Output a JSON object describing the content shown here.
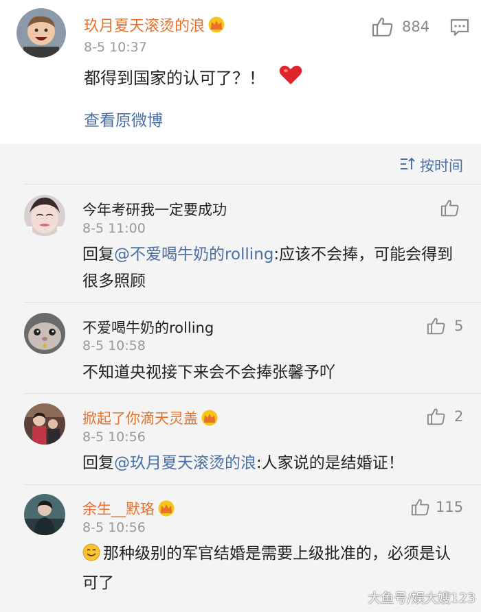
{
  "post": {
    "username": "玖月夏天滚烫的浪",
    "time": "8-5 10:37",
    "content": "都得到国家的认可了？！",
    "likes": "884",
    "view_original": "查看原微博"
  },
  "sort_label": "按时间",
  "comments": [
    {
      "username": "今年考研我一定要成功",
      "time": "8-5 11:00",
      "reply_prefix": "回复",
      "mention": "@不爱喝牛奶的rolling",
      "text": ":应该不会捧，可能会得到很多照顾",
      "likes": ""
    },
    {
      "username": "不爱喝牛奶的rolling",
      "time": "8-5 10:58",
      "text": "不知道央视接下来会不会捧张馨予吖",
      "likes": "5"
    },
    {
      "username": "掀起了你滴天灵盖",
      "time": "8-5 10:56",
      "reply_prefix": "回复",
      "mention": "@玖月夏天滚烫的浪",
      "text": ":人家说的是结婚证！",
      "likes": "2"
    },
    {
      "username": "余生__默珞",
      "time": "8-5 10:56",
      "text": "那种级别的军官结婚是需要上级批准的，必须是认可了",
      "likes": "115"
    }
  ],
  "watermark": "大鱼号/娱大嫂123",
  "colors": {
    "username_vip": "#e8702a",
    "link": "#4a6fa5",
    "meta": "#999999",
    "background": "#f4f4f4"
  }
}
